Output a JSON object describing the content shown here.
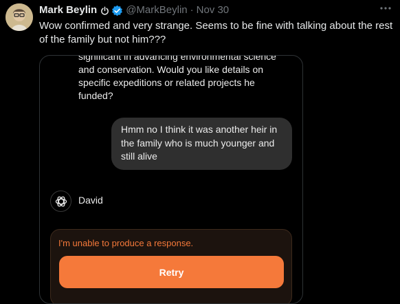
{
  "post": {
    "author_name": "Mark Beylin",
    "handle": "@MarkBeylin",
    "separator": "·",
    "date": "Nov 30",
    "more_icon": "more-horizontal-icon",
    "text": "Wow confirmed and very strange. Seems to be fine with talking about the rest of the family but not him???"
  },
  "colors": {
    "background": "#000000",
    "verified": "#1d9bf0",
    "accent_orange": "#f5793a",
    "bubble": "#2f2f2f",
    "muted": "#71767b"
  },
  "chat": {
    "assistant_lines": [
      "significant in advancing environmental science",
      "and conservation. Would you like details on",
      "specific expeditions or related projects he",
      "funded?"
    ],
    "user_lines": [
      "Hmm no I think it was another heir in",
      "the family who is much younger and",
      "still alive"
    ],
    "bot_icon": "openai-logo-icon",
    "bot_name": "David",
    "error_message": "I'm unable to produce a response.",
    "retry_label": "Retry"
  }
}
